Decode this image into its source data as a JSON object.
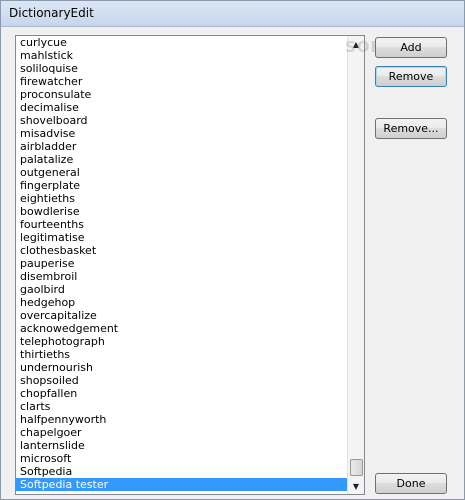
{
  "window": {
    "title": "DictionaryEdit"
  },
  "word_list": {
    "items": [
      "curlycue",
      "mahlstick",
      "soliloquise",
      "firewatcher",
      "proconsulate",
      "decimalise",
      "shovelboard",
      "misadvise",
      "airbladder",
      "palatalize",
      "outgeneral",
      "fingerplate",
      "eightieths",
      "bowdlerise",
      "fourteenths",
      "legitimatise",
      "clothesbasket",
      "pauperise",
      "disembroil",
      "gaolbird",
      "hedgehop",
      "overcapitalize",
      "acknowedgement",
      "telephotograph",
      "thirtieths",
      "undernourish",
      "shopsoiled",
      "chopfallen",
      "clarts",
      "halfpennyworth",
      "chapelgoer",
      "lanternslide",
      "microsoft",
      "Softpedia",
      "Softpedia tester"
    ],
    "selected_item": "Softpedia tester"
  },
  "buttons": {
    "add": "Add",
    "remove": "Remove",
    "remove_file": "Remove...",
    "done": "Done"
  },
  "watermark": "SOFTPEDIA"
}
